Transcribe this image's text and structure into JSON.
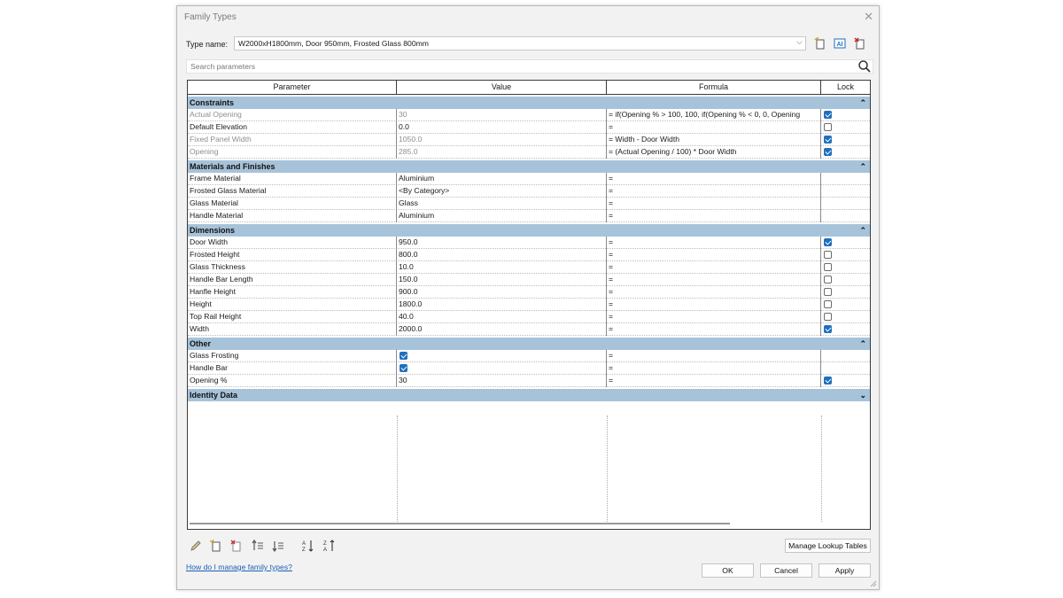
{
  "window": {
    "title": "Family Types"
  },
  "type_name": {
    "label": "Type name:",
    "value": "W2000xH1800mm, Door 950mm, Frosted Glass 800mm"
  },
  "search": {
    "placeholder": "Search parameters"
  },
  "columns": [
    "Parameter",
    "Value",
    "Formula",
    "Lock"
  ],
  "groups": [
    {
      "name": "Constraints",
      "collapsed": false,
      "rows": [
        {
          "parameter": "Actual Opening",
          "value": "30",
          "formula": "= if(Opening % > 100, 100, if(Opening % < 0, 0, Opening",
          "lock": true,
          "readonly": true
        },
        {
          "parameter": "Default Elevation",
          "value": "0.0",
          "formula": "=",
          "lock": false,
          "readonly": false
        },
        {
          "parameter": "Fixed Panel Width",
          "value": "1050.0",
          "formula": "= Width - Door Width",
          "lock": true,
          "readonly": true
        },
        {
          "parameter": "Opening",
          "value": "285.0",
          "formula": "= (Actual Opening / 100) * Door Width",
          "lock": true,
          "readonly": true
        }
      ]
    },
    {
      "name": "Materials and Finishes",
      "collapsed": false,
      "rows": [
        {
          "parameter": "Frame Material",
          "value": "Aluminium",
          "formula": "=",
          "lock": null
        },
        {
          "parameter": "Frosted Glass Material",
          "value": "<By Category>",
          "formula": "=",
          "lock": null
        },
        {
          "parameter": "Glass Material",
          "value": "Glass",
          "formula": "=",
          "lock": null
        },
        {
          "parameter": "Handle Material",
          "value": "Aluminium",
          "formula": "=",
          "lock": null
        }
      ]
    },
    {
      "name": "Dimensions",
      "collapsed": false,
      "rows": [
        {
          "parameter": "Door Width",
          "value": "950.0",
          "formula": "=",
          "lock": true
        },
        {
          "parameter": "Frosted Height",
          "value": "800.0",
          "formula": "=",
          "lock": false
        },
        {
          "parameter": "Glass Thickness",
          "value": "10.0",
          "formula": "=",
          "lock": false
        },
        {
          "parameter": "Handle Bar Length",
          "value": "150.0",
          "formula": "=",
          "lock": false
        },
        {
          "parameter": "Hanfle Height",
          "value": "900.0",
          "formula": "=",
          "lock": false
        },
        {
          "parameter": "Height",
          "value": "1800.0",
          "formula": "=",
          "lock": false
        },
        {
          "parameter": "Top Rail Height",
          "value": "40.0",
          "formula": "=",
          "lock": false
        },
        {
          "parameter": "Width",
          "value": "2000.0",
          "formula": "=",
          "lock": true
        }
      ]
    },
    {
      "name": "Other",
      "collapsed": false,
      "rows": [
        {
          "parameter": "Glass Frosting",
          "value_checkbox": true,
          "formula": "=",
          "lock": null
        },
        {
          "parameter": "Handle Bar",
          "value_checkbox": true,
          "formula": "=",
          "lock": null
        },
        {
          "parameter": "Opening %",
          "value": "30",
          "formula": "=",
          "lock": true
        }
      ]
    },
    {
      "name": "Identity Data",
      "collapsed": true,
      "rows": []
    }
  ],
  "bottom_icons": [
    "pencil-icon",
    "new-parameter-icon",
    "delete-parameter-icon",
    "move-up-icon",
    "move-down-icon",
    "sort-ascending-icon",
    "sort-descending-icon"
  ],
  "buttons": {
    "manage_lookup": "Manage Lookup Tables",
    "ok": "OK",
    "cancel": "Cancel",
    "apply": "Apply"
  },
  "help_link": "How do I manage family types?",
  "colors": {
    "group_header": "#a7c3da",
    "checkbox_on": "#1f6fbf",
    "link": "#1a5fb4"
  }
}
